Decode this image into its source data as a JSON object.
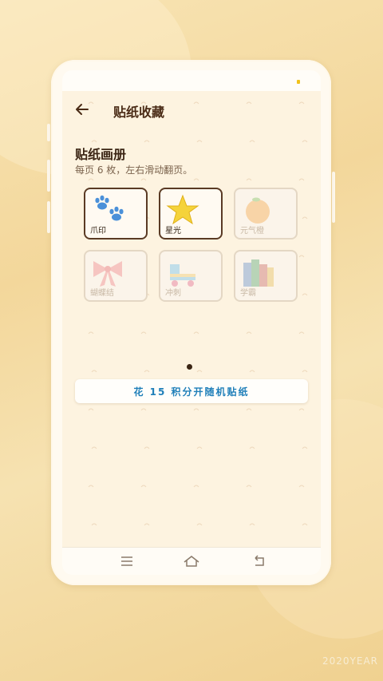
{
  "app": {
    "title": "贴纸收藏",
    "back_icon": "arrow-left-icon"
  },
  "album": {
    "title": "贴纸画册",
    "description": "每页 6 枚，左右滑动翻页。",
    "stickers": [
      {
        "label": "爪印",
        "icon": "paw-icon",
        "owned": true
      },
      {
        "label": "星光",
        "icon": "star-icon",
        "owned": true
      },
      {
        "label": "元气橙",
        "icon": "orange-icon",
        "owned": false
      },
      {
        "label": "蝴蝶结",
        "icon": "bow-icon",
        "owned": false
      },
      {
        "label": "冲刺",
        "icon": "roller-skate-icon",
        "owned": false
      },
      {
        "label": "学霸",
        "icon": "books-icon",
        "owned": false
      }
    ],
    "pager": {
      "current_page": 1,
      "total_pages": 1
    }
  },
  "draw_button": {
    "label": "花 15 积分开随机贴纸"
  },
  "nav": {
    "icons": [
      "menu-icon",
      "home-icon",
      "back-return-icon"
    ]
  },
  "watermark": "2020YEAR",
  "colors": {
    "accent_text": "#1f7fb9",
    "owned_border": "#5a3a24",
    "background": "#fdf3e0",
    "status_dot": "#f1c21b"
  }
}
